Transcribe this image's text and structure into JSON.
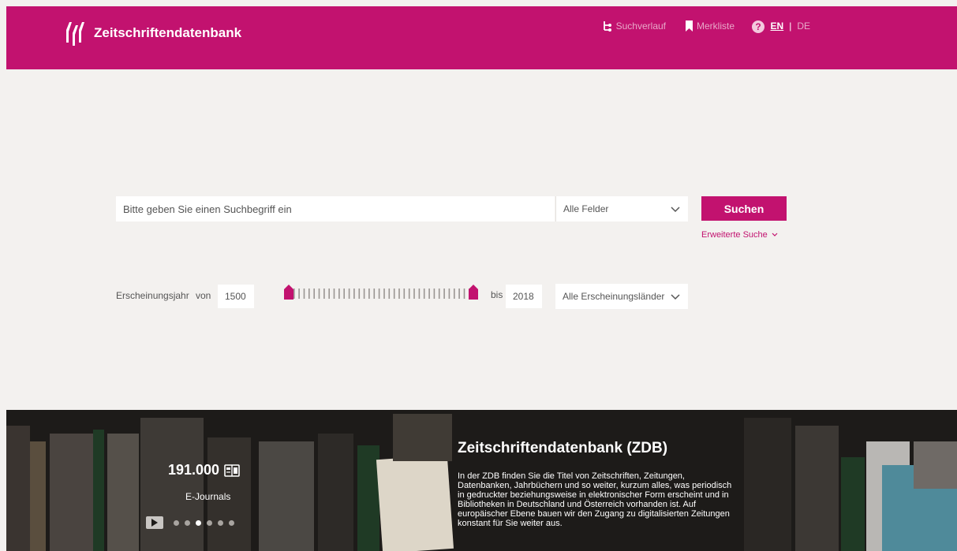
{
  "header": {
    "brand": "Zeitschriftendatenbank",
    "nav": {
      "history_label": "Suchverlauf",
      "bookmarks_label": "Merkliste",
      "help_glyph": "?",
      "lang_en": "EN",
      "lang_sep": "|",
      "lang_de": "DE"
    }
  },
  "search": {
    "placeholder": "Bitte geben Sie einen Suchbegriff ein",
    "field_select": "Alle Felder",
    "button_label": "Suchen",
    "advanced_label": "Erweiterte Suche"
  },
  "year_filter": {
    "label": "Erscheinungsjahr",
    "from_label": "von",
    "from_value": "1500",
    "to_label": "bis",
    "to_value": "2018",
    "country_select": "Alle Erscheinungsländer"
  },
  "hero": {
    "stat_number": "191.000",
    "stat_label": "E-Journals",
    "carousel_total": 6,
    "carousel_active": 2,
    "title": "Zeitschriftendatenbank (ZDB)",
    "text": "In der ZDB finden Sie die Titel von Zeitschriften, Zeitungen, Datenbanken, Jahrbüchern und so weiter, kurzum alles, was periodisch in gedruckter beziehungsweise in elektronischer Form erscheint und in Bibliotheken in Deutschland und Österreich vorhanden ist. Auf europäischer Ebene bauen wir den Zugang zu digitalisierten Zeitungen konstant für Sie weiter aus."
  },
  "colors": {
    "brand": "#c2126f",
    "page_bg": "#f3f1ef"
  },
  "icons": {
    "logo": "zdb-logo-icon",
    "history": "history-icon",
    "bookmark": "bookmark-icon",
    "help": "help-icon",
    "journal": "journal-icon",
    "play": "play-icon"
  }
}
